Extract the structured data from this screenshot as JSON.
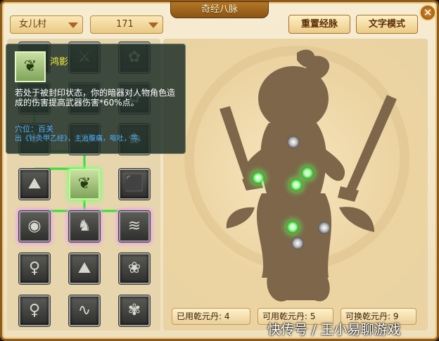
{
  "window": {
    "title": "奇经八脉",
    "close_glyph": "✕"
  },
  "selects": {
    "sect": "女儿村",
    "level": "171"
  },
  "buttons": {
    "reset": "重置经脉",
    "text_mode": "文字模式"
  },
  "skills": [
    {
      "name": "skill-tile",
      "glyph": "❦"
    },
    {
      "name": "skill-tile",
      "glyph": "⚔"
    },
    {
      "name": "skill-tile",
      "glyph": "✿"
    },
    {
      "name": "skill-tile",
      "glyph": "❦"
    },
    {
      "name": "skill-tile",
      "glyph": "⚔"
    },
    {
      "name": "skill-tile",
      "glyph": "✿"
    },
    {
      "name": "skill-tile",
      "glyph": "❦"
    },
    {
      "name": "skill-tile",
      "glyph": "⚔"
    },
    {
      "name": "skill-tile",
      "glyph": "✿"
    },
    {
      "name": "skill-tile",
      "glyph": "⛰"
    },
    {
      "name": "skill-tile-selected",
      "glyph": "❦"
    },
    {
      "name": "skill-tile",
      "glyph": "⬛"
    },
    {
      "name": "skill-tile",
      "glyph": "◉"
    },
    {
      "name": "skill-tile",
      "glyph": "♞"
    },
    {
      "name": "skill-tile",
      "glyph": "≋"
    },
    {
      "name": "skill-tile",
      "glyph": "♀"
    },
    {
      "name": "skill-tile",
      "glyph": "⛰"
    },
    {
      "name": "skill-tile",
      "glyph": "❀"
    },
    {
      "name": "skill-tile",
      "glyph": "♀"
    },
    {
      "name": "skill-tile",
      "glyph": "∿"
    },
    {
      "name": "skill-tile",
      "glyph": "✾"
    }
  ],
  "tooltip": {
    "icon_glyph": "❦",
    "name": "鸿影",
    "desc": "若处于被封印状态，你的暗器对人物角色造成的伤害提高武器伤害*60%点。",
    "acupoint": "穴位：百关",
    "source": "出《针灸甲乙经》，主治腹痛，呕吐，等。"
  },
  "stats": {
    "used": "已用乾元丹: 4",
    "available": "可用乾元丹: 5",
    "exchangeable": "可换乾元丹: 9"
  },
  "watermark": "快传号 / 王小易聊游戏",
  "colors": {
    "lit": "#38e638",
    "frame": "#8c5a1d",
    "tooltip_name": "#f7f03a",
    "tooltip_link": "#4fb3ff"
  }
}
